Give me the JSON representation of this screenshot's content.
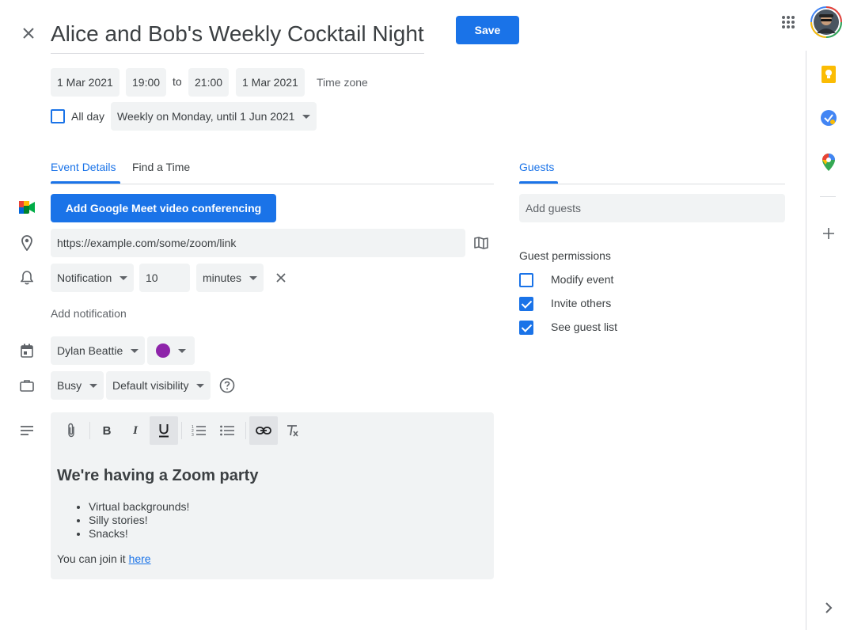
{
  "header": {
    "title": "Alice and Bob's Weekly Cocktail Night",
    "save_label": "Save"
  },
  "datetime": {
    "start_date": "1 Mar 2021",
    "start_time": "19:00",
    "to_label": "to",
    "end_time": "21:00",
    "end_date": "1 Mar 2021",
    "timezone_label": "Time zone",
    "allday_label": "All day",
    "allday_checked": false,
    "recurrence": "Weekly on Monday, until 1 Jun 2021"
  },
  "tabs": {
    "event_details": "Event Details",
    "find_time": "Find a Time",
    "guests": "Guests"
  },
  "details": {
    "meet_button": "Add Google Meet video conferencing",
    "location_value": "https://example.com/some/zoom/link",
    "notification_type": "Notification",
    "notification_amount": "10",
    "notification_unit": "minutes",
    "add_notification": "Add notification",
    "calendar_owner": "Dylan Beattie",
    "event_color": "#8e24aa",
    "availability": "Busy",
    "visibility": "Default visibility"
  },
  "description": {
    "heading": "We're having a Zoom party",
    "bullets": [
      "Virtual backgrounds!",
      "Silly stories!",
      "Snacks!"
    ],
    "join_text": "You can join it ",
    "join_link": "here"
  },
  "guests": {
    "add_placeholder": "Add guests",
    "permissions_label": "Guest permissions",
    "permissions": [
      {
        "label": "Modify event",
        "checked": false
      },
      {
        "label": "Invite others",
        "checked": true
      },
      {
        "label": "See guest list",
        "checked": true
      }
    ]
  },
  "colors": {
    "accent": "#1a73e8",
    "chip_bg": "#f1f3f4",
    "text": "#3c4043"
  },
  "icons": {
    "close": "close-icon",
    "apps": "apps-grid-icon",
    "meet": "google-meet-icon",
    "location": "location-pin-icon",
    "notification": "bell-icon",
    "calendar": "calendar-icon",
    "busy": "briefcase-icon",
    "description": "notes-icon",
    "keep": "keep-icon",
    "tasks": "tasks-icon",
    "maps": "maps-icon"
  }
}
